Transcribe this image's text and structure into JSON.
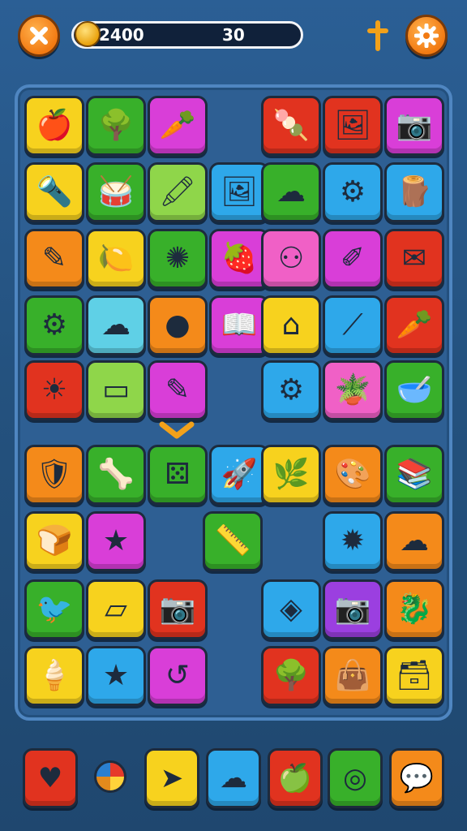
{
  "hud": {
    "score": "2400",
    "count": "30"
  },
  "colors": {
    "yellow": "#f7d21e",
    "green": "#38b02a",
    "magenta": "#d93ed8",
    "red": "#e1331f",
    "blue": "#2ea8ea",
    "orange": "#f48a1a",
    "lime": "#8fd64a",
    "pink": "#f060c6",
    "cyan": "#5fd0e6",
    "purple": "#9b3fe0"
  },
  "board": {
    "tiles": [
      {
        "color": "#f7d21e",
        "icon": "apple-icon",
        "glyph": "🍎"
      },
      {
        "color": "#38b02a",
        "icon": "tree-icon",
        "glyph": "🌳"
      },
      {
        "color": "#d93ed8",
        "icon": "carrot-icon",
        "glyph": "🥕"
      },
      {
        "color": "#e1331f",
        "icon": "popsicle-icon",
        "glyph": "🍡"
      },
      {
        "color": "#e1331f",
        "icon": "picture-icon",
        "glyph": "🖼"
      },
      {
        "color": "#d93ed8",
        "icon": "camera-icon",
        "glyph": "📷"
      },
      {
        "color": "#f7d21e",
        "icon": "torch-icon",
        "glyph": "🔦"
      },
      {
        "color": "#38b02a",
        "icon": "drum-icon",
        "glyph": "🥁"
      },
      {
        "color": "#8fd64a",
        "icon": "crayon-icon",
        "glyph": "🖍"
      },
      {
        "color": "#2ea8ea",
        "icon": "frame-icon",
        "glyph": "🖼"
      },
      {
        "color": "#38b02a",
        "icon": "cloud-icon",
        "glyph": "☁"
      },
      {
        "color": "#2ea8ea",
        "icon": "gear-icon",
        "glyph": "⚙"
      },
      {
        "color": "#2ea8ea",
        "icon": "wood-block-icon",
        "glyph": "🪵"
      },
      {
        "color": "#f48a1a",
        "icon": "pen-icon",
        "glyph": "✎"
      },
      {
        "color": "#f7d21e",
        "icon": "lemon-icon",
        "glyph": "🍋"
      },
      {
        "color": "#38b02a",
        "icon": "virus-icon",
        "glyph": "✺"
      },
      {
        "color": "#d93ed8",
        "icon": "strawberry-icon",
        "glyph": "🍓"
      },
      {
        "color": "#f060c6",
        "icon": "tablet-icon",
        "glyph": "⚇"
      },
      {
        "color": "#d93ed8",
        "icon": "easel-icon",
        "glyph": "✐"
      },
      {
        "color": "#e1331f",
        "icon": "envelope-icon",
        "glyph": "✉"
      },
      {
        "color": "#38b02a",
        "icon": "gear-icon",
        "glyph": "⚙"
      },
      {
        "color": "#5fd0e6",
        "icon": "cloud-icon",
        "glyph": "☁"
      },
      {
        "color": "#f48a1a",
        "icon": "orb-icon",
        "glyph": "●"
      },
      {
        "color": "#d93ed8",
        "icon": "book-icon",
        "glyph": "📖"
      },
      {
        "color": "#f7d21e",
        "icon": "stapler-icon",
        "glyph": "⌂"
      },
      {
        "color": "#2ea8ea",
        "icon": "stick-icon",
        "glyph": "⟋"
      },
      {
        "color": "#e1331f",
        "icon": "carrot-icon",
        "glyph": "🥕"
      },
      {
        "color": "#e1331f",
        "icon": "sun-frame-icon",
        "glyph": "☀"
      },
      {
        "color": "#8fd64a",
        "icon": "log-icon",
        "glyph": "▭"
      },
      {
        "color": "#d93ed8",
        "icon": "pencil-card-icon",
        "glyph": "✎"
      },
      {
        "color": "#2ea8ea",
        "icon": "gear-icon",
        "glyph": "⚙"
      },
      {
        "color": "#f060c6",
        "icon": "potted-plant-icon",
        "glyph": "🪴"
      },
      {
        "color": "#38b02a",
        "icon": "bowl-icon",
        "glyph": "🥣"
      },
      {
        "color": "#f48a1a",
        "icon": "chest-icon",
        "glyph": "🛡"
      },
      {
        "color": "#38b02a",
        "icon": "bone-icon",
        "glyph": "🦴"
      },
      {
        "color": "#38b02a",
        "icon": "dice-icon",
        "glyph": "⚄"
      },
      {
        "color": "#2ea8ea",
        "icon": "rocket-icon",
        "glyph": "🚀"
      },
      {
        "color": "#f7d21e",
        "icon": "leaf-stick-icon",
        "glyph": "🌿"
      },
      {
        "color": "#f48a1a",
        "icon": "palette-icon",
        "glyph": "🎨"
      },
      {
        "color": "#38b02a",
        "icon": "books-icon",
        "glyph": "📚"
      },
      {
        "color": "#f7d21e",
        "icon": "bread-icon",
        "glyph": "🍞"
      },
      {
        "color": "#d93ed8",
        "icon": "star-icon",
        "glyph": "★"
      },
      {
        "color": "#38b02a",
        "icon": "ruler-icon",
        "glyph": "📏"
      },
      {
        "color": "#2ea8ea",
        "icon": "sun-gear-icon",
        "glyph": "✹"
      },
      {
        "color": "#f48a1a",
        "icon": "cloud-icon",
        "glyph": "☁"
      },
      {
        "color": "#38b02a",
        "icon": "bird-icon",
        "glyph": "🐦"
      },
      {
        "color": "#f7d21e",
        "icon": "eraser-icon",
        "glyph": "▱"
      },
      {
        "color": "#e1331f",
        "icon": "camera-icon",
        "glyph": "📷"
      },
      {
        "color": "#2ea8ea",
        "icon": "badge-icon",
        "glyph": "◈"
      },
      {
        "color": "#9b3fe0",
        "icon": "camera-icon",
        "glyph": "📷"
      },
      {
        "color": "#f48a1a",
        "icon": "dragon-icon",
        "glyph": "🐉"
      },
      {
        "color": "#f7d21e",
        "icon": "ice-cream-icon",
        "glyph": "🍦"
      },
      {
        "color": "#2ea8ea",
        "icon": "star-icon",
        "glyph": "★"
      },
      {
        "color": "#d93ed8",
        "icon": "swirl-icon",
        "glyph": "↺"
      },
      {
        "color": "#e1331f",
        "icon": "tree-icon",
        "glyph": "🌳"
      },
      {
        "color": "#f48a1a",
        "icon": "bag-icon",
        "glyph": "👜"
      },
      {
        "color": "#f7d21e",
        "icon": "chest-icon",
        "glyph": "🗃"
      }
    ]
  },
  "tray": {
    "tiles": [
      {
        "color": "#e1331f",
        "icon": "heart-icon",
        "glyph": "♥"
      },
      {
        "color": "#f7d21e",
        "icon": "paper-plane-icon",
        "glyph": "➤"
      },
      {
        "color": "#2ea8ea",
        "icon": "cloud-icon",
        "glyph": "☁"
      },
      {
        "color": "#e1331f",
        "icon": "apple-icon",
        "glyph": "🍏"
      },
      {
        "color": "#38b02a",
        "icon": "ring-icon",
        "glyph": "◎"
      },
      {
        "color": "#f48a1a",
        "icon": "speech-bubble-icon",
        "glyph": "💬"
      }
    ],
    "ball_icon": "beach-ball-icon"
  }
}
